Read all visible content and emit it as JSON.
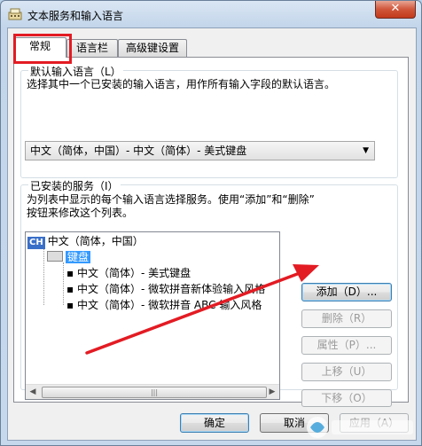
{
  "window": {
    "title": "文本服务和输入语言",
    "close_glyph": "✕"
  },
  "tabs": [
    {
      "label": "常规",
      "active": true
    },
    {
      "label": "语言栏",
      "active": false
    },
    {
      "label": "高级键设置",
      "active": false
    }
  ],
  "default_language": {
    "legend": "默认输入语言（L）",
    "description": "选择其中一个已安装的输入语言，用作所有输入字段的默认语言。",
    "selected": "中文（简体，中国）- 中文（简体）- 美式键盘"
  },
  "installed_services": {
    "legend": "已安装的服务（I）",
    "description_line1": "为列表中显示的每个输入语言选择服务。使用“添加”和“删除”",
    "description_line2": "按钮来修改这个列表。",
    "tree": {
      "language_badge": "CH",
      "language": "中文（简体，中国）",
      "group_label": "键盘",
      "items": [
        "中文（简体）- 美式键盘",
        "中文（简体）- 微软拼音新体验输入风格",
        "中文（简体）- 微软拼音 ABC 输入风格"
      ]
    },
    "buttons": {
      "add": "添加（D）...",
      "remove": "删除（R）",
      "properties": "属性（P）...",
      "move_up": "上移（U）",
      "move_down": "下移（O）"
    }
  },
  "footer": {
    "ok": "确定",
    "cancel": "取消",
    "apply": "应用（A）"
  },
  "colors": {
    "highlight": "#e31b23",
    "selection": "#3399ff"
  }
}
